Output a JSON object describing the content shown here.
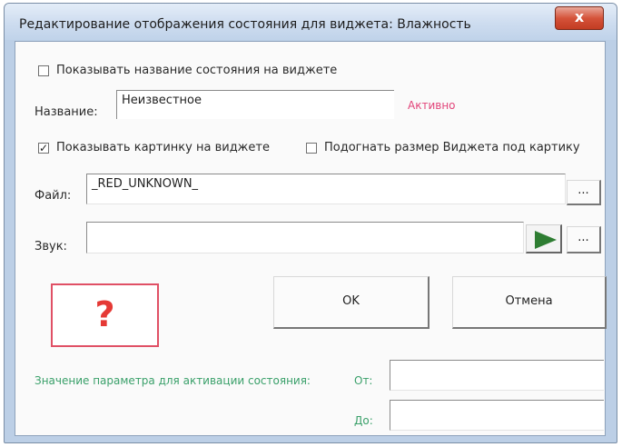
{
  "window": {
    "title": "Редактирование отображения состояния для виджета: Влажность",
    "close_label": "x"
  },
  "state_name": {
    "show_label": "Показывать название состояния на виджете",
    "show_checked": false,
    "label": "Название:",
    "value": "Неизвестное",
    "active_text": "Активно"
  },
  "picture": {
    "show_label": "Показывать картинку на виджете",
    "show_checked": true,
    "fit_label": "Подогнать размер Виджета под картику",
    "fit_checked": false
  },
  "file": {
    "label": "Файл:",
    "value": "_RED_UNKNOWN_",
    "browse_label": "..."
  },
  "sound": {
    "label": "Звук:",
    "value": "",
    "browse_label": "...",
    "play_icon": "play-icon"
  },
  "preview": {
    "glyph": "?",
    "icon": "question-mark-icon"
  },
  "buttons": {
    "ok": "OK",
    "cancel": "Отмена"
  },
  "activation": {
    "label": "Значение параметра для активации состояния:",
    "from_label": "От:",
    "from_value": "",
    "to_label": "До:",
    "to_value": ""
  },
  "colors": {
    "activation_text": "#3aa06a",
    "active_text": "#e2457a",
    "question_mark": "#e53935",
    "play_icon": "#2e7d32"
  }
}
